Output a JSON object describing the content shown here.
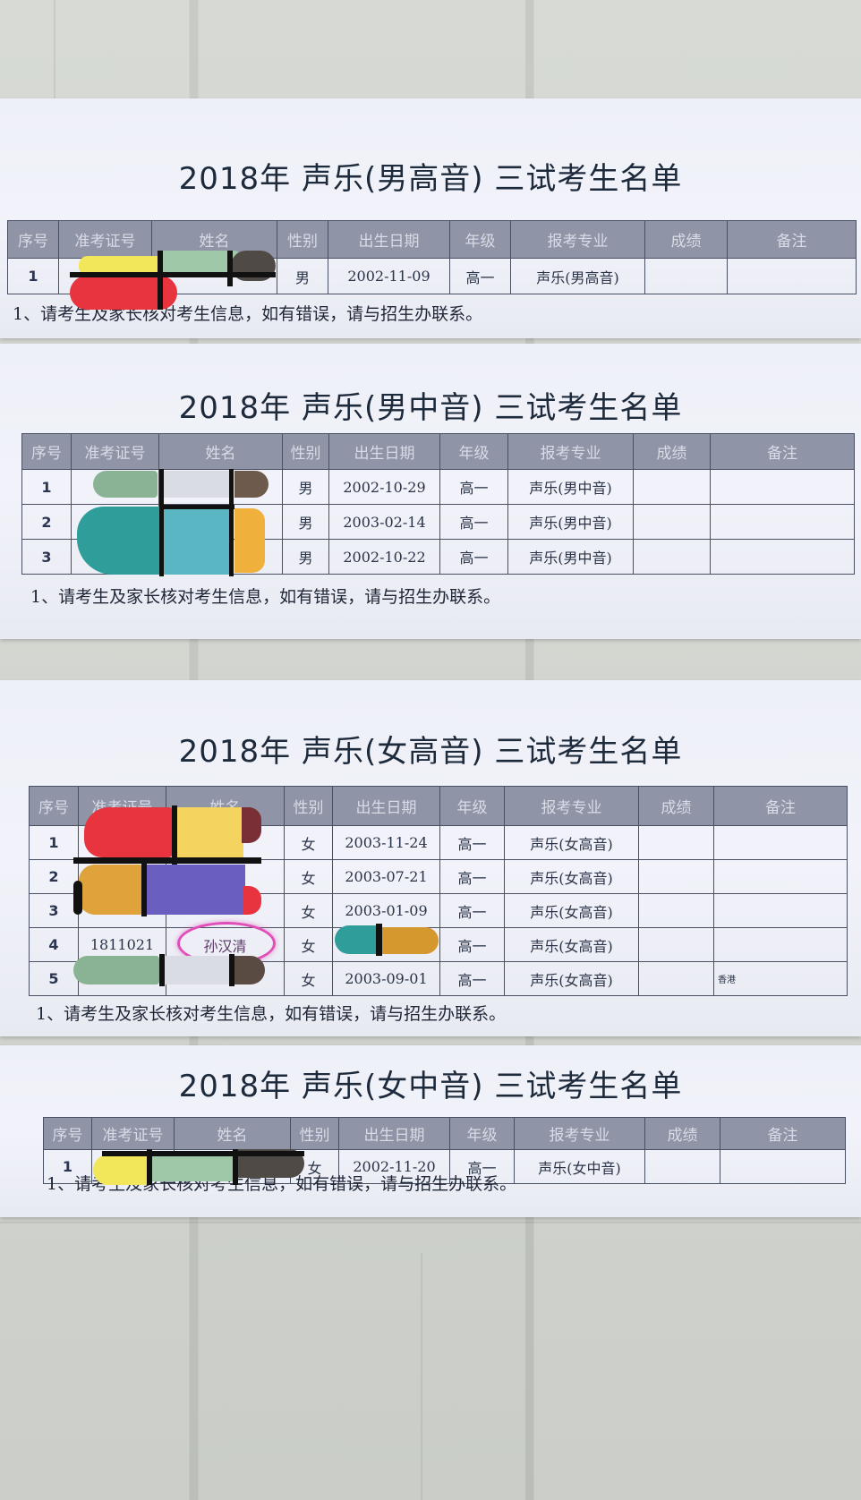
{
  "columns": [
    "序号",
    "准考证号",
    "姓名",
    "性别",
    "出生日期",
    "年级",
    "报考专业",
    "成绩",
    "备注"
  ],
  "note": "1、请考生及家长核对考生信息，如有错误，请与招生办联系。",
  "sections": [
    {
      "title": "2018年  声乐(男高音)  三试考生名单",
      "rows": [
        {
          "seq": "1",
          "id": "",
          "name": "",
          "gender": "男",
          "dob": "2002-11-09",
          "grade": "高一",
          "major": "声乐(男高音)",
          "score": "",
          "remark": ""
        }
      ]
    },
    {
      "title": "2018年  声乐(男中音)  三试考生名单",
      "rows": [
        {
          "seq": "1",
          "id": "",
          "name": "",
          "gender": "男",
          "dob": "2002-10-29",
          "grade": "高一",
          "major": "声乐(男中音)",
          "score": "",
          "remark": ""
        },
        {
          "seq": "2",
          "id": "",
          "name": "",
          "gender": "男",
          "dob": "2003-02-14",
          "grade": "高一",
          "major": "声乐(男中音)",
          "score": "",
          "remark": ""
        },
        {
          "seq": "3",
          "id": "",
          "name": "",
          "gender": "男",
          "dob": "2002-10-22",
          "grade": "高一",
          "major": "声乐(男中音)",
          "score": "",
          "remark": ""
        }
      ]
    },
    {
      "title": "2018年  声乐(女高音)  三试考生名单",
      "rows": [
        {
          "seq": "1",
          "id": "",
          "name": "",
          "gender": "女",
          "dob": "2003-11-24",
          "grade": "高一",
          "major": "声乐(女高音)",
          "score": "",
          "remark": ""
        },
        {
          "seq": "2",
          "id": "",
          "name": "",
          "gender": "女",
          "dob": "2003-07-21",
          "grade": "高一",
          "major": "声乐(女高音)",
          "score": "",
          "remark": ""
        },
        {
          "seq": "3",
          "id": "",
          "name": "",
          "gender": "女",
          "dob": "2003-01-09",
          "grade": "高一",
          "major": "声乐(女高音)",
          "score": "",
          "remark": ""
        },
        {
          "seq": "4",
          "id": "1811021",
          "name": "孙汉清",
          "gender": "女",
          "dob": "",
          "grade": "高一",
          "major": "声乐(女高音)",
          "score": "",
          "remark": ""
        },
        {
          "seq": "5",
          "id": "",
          "name": "",
          "gender": "女",
          "dob": "2003-09-01",
          "grade": "高一",
          "major": "声乐(女高音)",
          "score": "",
          "remark": "香港"
        }
      ]
    },
    {
      "title": "2018年  声乐(女中音)  三试考生名单",
      "rows": [
        {
          "seq": "1",
          "id": "",
          "name": "",
          "gender": "女",
          "dob": "2002-11-20",
          "grade": "高一",
          "major": "声乐(女中音)",
          "score": "",
          "remark": ""
        }
      ]
    }
  ],
  "colors": {
    "header_fill": "#8f94a7",
    "grid_line": "#4a5063",
    "highlight_circle": "#e04fb8",
    "redaction_palette": [
      "#e8343f",
      "#f4d35e",
      "#89b394",
      "#4f4a46",
      "#2f9e9b",
      "#e0a23a",
      "#6a5fc1",
      "#d9dde3",
      "#9fc8a8",
      "#f2e65a"
    ]
  }
}
